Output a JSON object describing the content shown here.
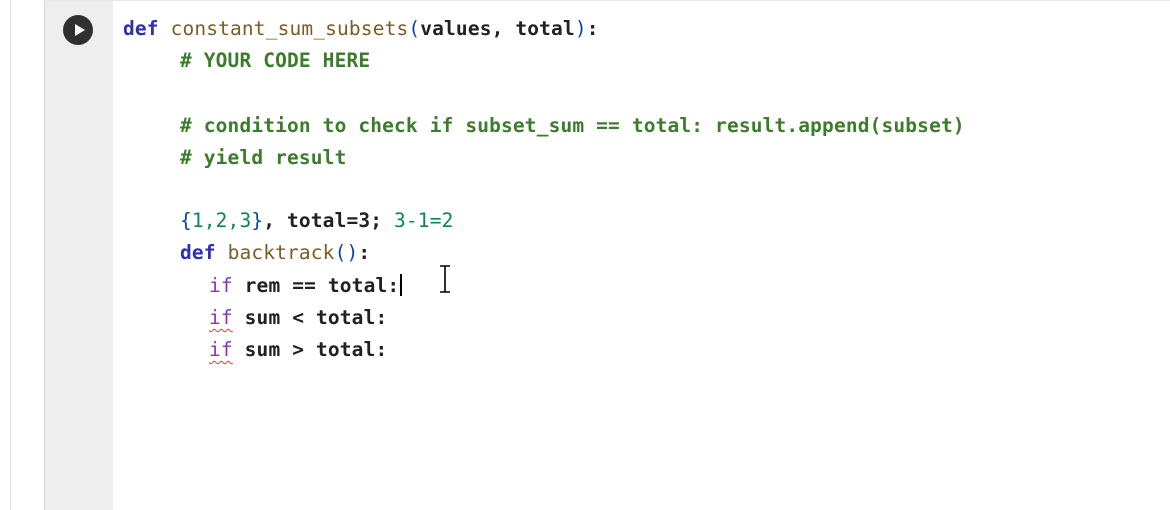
{
  "cell": {
    "run_button": {
      "icon": "play-icon",
      "color": "#303030"
    },
    "code": {
      "line1": {
        "kw": "def",
        "fn": "constant_sum_subsets",
        "open": "(",
        "args": "values, total",
        "close": ")",
        "colon": ":"
      },
      "line2": "# YOUR CODE HERE",
      "line3": "# condition to check if subset_sum == total: result.append(subset)",
      "line4": "# yield result",
      "line5": {
        "open": "{",
        "nums": "1,2,3",
        "close": "}",
        "text": ", total=3; ",
        "expr": "3-1=2"
      },
      "line6": {
        "kw": "def",
        "fn": "backtrack",
        "parens": "()",
        "colon": ":"
      },
      "line7": {
        "kw": "if",
        "rest": "rem == total:"
      },
      "line8": {
        "kw": "if",
        "rest": "sum < total:"
      },
      "line9": {
        "kw": "if",
        "rest": "sum > total:"
      }
    }
  },
  "colors": {
    "keyword": "#2f2fb0",
    "comment": "#3c7d2b",
    "function": "#795e26",
    "gutter": "#eeeeee",
    "error_squiggle": "#e53935"
  }
}
